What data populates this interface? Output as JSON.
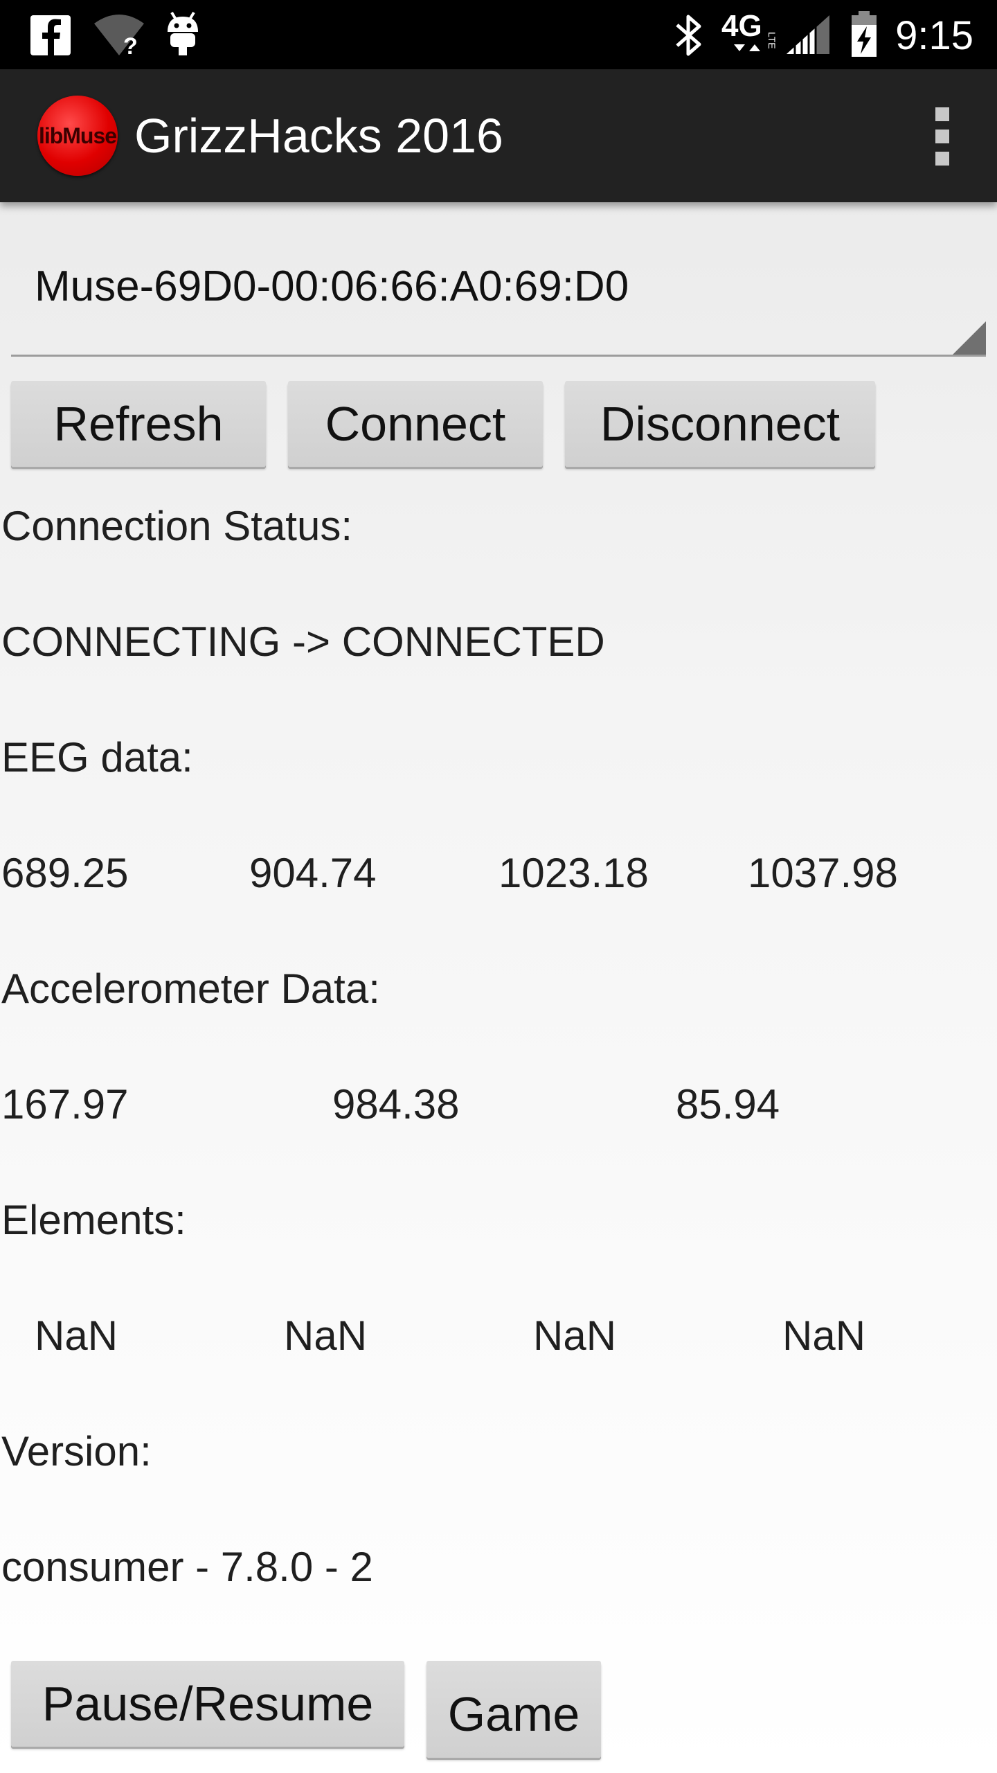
{
  "status_bar": {
    "time": "9:15",
    "network": "4G LTE",
    "icons": [
      "facebook-icon",
      "wifi-unknown-icon",
      "android-debug-icon",
      "bluetooth-icon",
      "lte-icon",
      "signal-icon",
      "battery-charging-icon"
    ]
  },
  "action_bar": {
    "logo_text": "libMuse",
    "title": "GrizzHacks 2016"
  },
  "device_spinner": {
    "selected": "Muse-69D0-00:06:66:A0:69:D0"
  },
  "buttons": {
    "refresh": "Refresh",
    "connect": "Connect",
    "disconnect": "Disconnect",
    "pause_resume": "Pause/Resume",
    "game": "Game"
  },
  "connection": {
    "label": "Connection Status:",
    "value": "CONNECTING -> CONNECTED"
  },
  "eeg": {
    "label": "EEG data:",
    "values": [
      "689.25",
      "904.74",
      "1023.18",
      "1037.98"
    ]
  },
  "accelerometer": {
    "label": "Accelerometer Data:",
    "values": [
      "167.97",
      "984.38",
      "85.94"
    ]
  },
  "elements": {
    "label": "Elements:",
    "values": [
      "NaN",
      "NaN",
      "NaN",
      "NaN"
    ]
  },
  "version": {
    "label": "Version:",
    "value": "consumer - 7.8.0 - 2"
  },
  "colors": {
    "status_bar_bg": "#000000",
    "action_bar_bg": "#222222",
    "logo_red": "#e00000",
    "button_bg": "#d6d6d6"
  }
}
